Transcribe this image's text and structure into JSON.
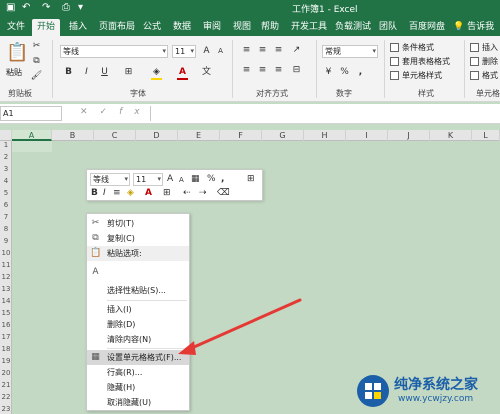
{
  "window": {
    "title": "工作簿1 - Excel"
  },
  "quick_access": {
    "save_icon": "save-icon",
    "undo_icon": "undo-icon",
    "redo_icon": "redo-icon",
    "print_icon": "print-preview-icon"
  },
  "tabs": [
    {
      "label": "文件"
    },
    {
      "label": "开始"
    },
    {
      "label": "插入"
    },
    {
      "label": "页面布局"
    },
    {
      "label": "公式"
    },
    {
      "label": "数据"
    },
    {
      "label": "审阅"
    },
    {
      "label": "视图"
    },
    {
      "label": "帮助"
    },
    {
      "label": "开发工具"
    },
    {
      "label": "负载测试"
    },
    {
      "label": "团队"
    },
    {
      "label": "百度网盘"
    },
    {
      "label": "告诉我"
    }
  ],
  "ribbon": {
    "clipboard": {
      "paste": "粘贴",
      "label": "剪贴板"
    },
    "font": {
      "name": "等线",
      "size": "11",
      "label": "字体",
      "bold": "B",
      "italic": "I",
      "underline": "U",
      "grow": "A",
      "shrink": "A",
      "color_letter": "A",
      "font_color": "#c00000",
      "fill_color": "#ffd600"
    },
    "alignment": {
      "label": "对齐方式"
    },
    "number": {
      "format": "常规",
      "label": "数字",
      "percent": "%",
      "comma": ","
    },
    "styles": {
      "conditional": "条件格式",
      "table": "套用表格格式",
      "cell": "单元格样式",
      "label": "样式"
    },
    "cells": {
      "insert": "插入",
      "delete": "删除",
      "format": "格式",
      "label": "单元格"
    }
  },
  "formula_bar": {
    "name_box": "A1",
    "cancel": "✕",
    "enter": "✓",
    "fx": "fx"
  },
  "columns": [
    "A",
    "B",
    "C",
    "D",
    "E",
    "F",
    "G",
    "H",
    "I",
    "J",
    "K",
    "L"
  ],
  "rows": [
    "1",
    "2",
    "3",
    "4",
    "5",
    "6",
    "7",
    "8",
    "9",
    "10",
    "11",
    "12",
    "13",
    "14",
    "15",
    "16",
    "17",
    "18",
    "19",
    "20",
    "21",
    "22",
    "23"
  ],
  "mini_toolbar": {
    "font": "等线",
    "size": "11",
    "bold": "B",
    "italic": "I",
    "align": "≡",
    "grow": "A",
    "shrink": "A",
    "color_letter": "A",
    "percent": "%",
    "comma": ","
  },
  "context_menu": {
    "items": [
      {
        "label": "剪切(T)",
        "icon": "scissors-icon"
      },
      {
        "label": "复制(C)",
        "icon": "copy-icon"
      },
      {
        "label": "粘贴选项:",
        "icon": "paste-icon"
      },
      {
        "label": "",
        "icon": "paste-text-icon"
      },
      {
        "label": "选择性粘贴(S)...",
        "icon": ""
      },
      {
        "label": "插入(I)",
        "icon": ""
      },
      {
        "label": "删除(D)",
        "icon": ""
      },
      {
        "label": "清除内容(N)",
        "icon": ""
      },
      {
        "label": "设置单元格格式(F)...",
        "icon": "format-cells-icon"
      },
      {
        "label": "行高(R)...",
        "icon": ""
      },
      {
        "label": "隐藏(H)",
        "icon": ""
      },
      {
        "label": "取消隐藏(U)",
        "icon": ""
      }
    ]
  },
  "annotation": {
    "color": "#e53935"
  },
  "watermark": {
    "title": "纯净系统之家",
    "url": "www.ycwjzy.com"
  }
}
